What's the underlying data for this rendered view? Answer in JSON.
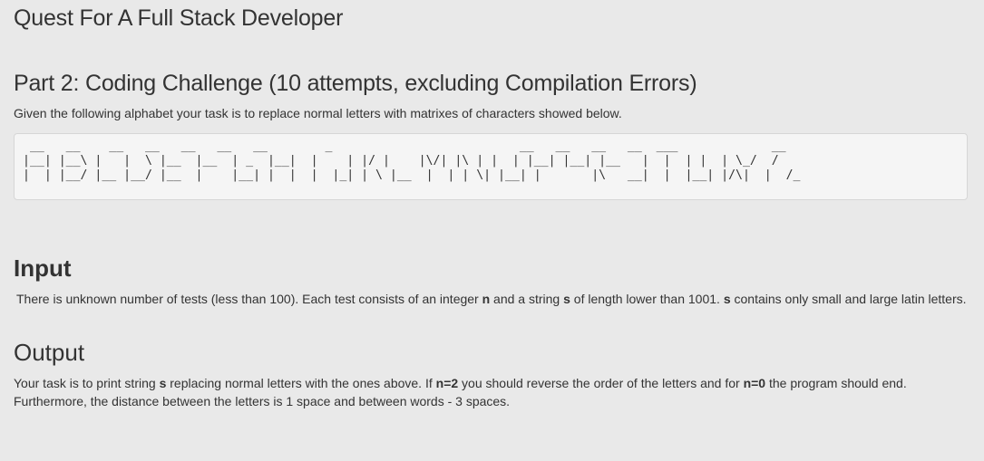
{
  "page": {
    "title": "Quest For A Full Stack Developer"
  },
  "part": {
    "heading": "Part 2: Coding Challenge (10 attempts, excluding Compilation Errors)",
    "intro": "Given the following alphabet your task is to replace normal letters with matrixes of characters showed below.",
    "ascii_art": " __   __    __   __   __   __   __        _                          __   __   __   __  ___             __\n|__| |__\\ |   |  \\ |__  |__  | _  |__|  |    | |/ |    |\\/| |\\ | |  | |__| |__| |__   |  |  | |  | \\_/  /\n|  | |__/ |__ |__/ |__  |    |__| |  |  |  |_| | \\ |__  |  | | \\| |__| |       |\\   __|  |  |__| |/\\|  |  /_"
  },
  "input": {
    "heading": "Input",
    "text_1": "There is unknown number of tests (less than 100). Each test consists of an integer ",
    "n": "n",
    "text_2": " and a string ",
    "s": "s",
    "text_3": " of length lower than 1001. ",
    "s2": "s",
    "text_4": " contains only small and large latin letters."
  },
  "output": {
    "heading": "Output",
    "text_1": "Your task is to print string ",
    "s": "s",
    "text_2": " replacing normal letters with the ones above. If ",
    "n2": "n=2",
    "text_3": " you should reverse the order of the letters and for ",
    "n0": "n=0",
    "text_4": " the program should end. Furthermore, the distance between the letters is 1 space and between words - 3 spaces."
  }
}
